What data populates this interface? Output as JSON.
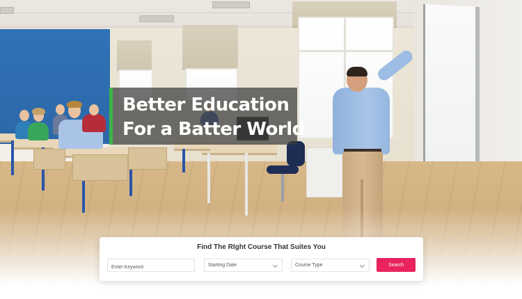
{
  "hero": {
    "headline_line1": "Better Education",
    "headline_line2": "For a Batter World",
    "accent_color": "#3ab54a",
    "background_image": "classroom-scene"
  },
  "search": {
    "title": "Find The RIght Course That Suites You",
    "keyword_placeholder": "Enter Keyword",
    "start_date_label": "Starting Date",
    "course_type_label": "Course Type",
    "button_label": "Search",
    "button_color": "#e8235d",
    "dropdown_icon": "chevron-down-icon"
  }
}
